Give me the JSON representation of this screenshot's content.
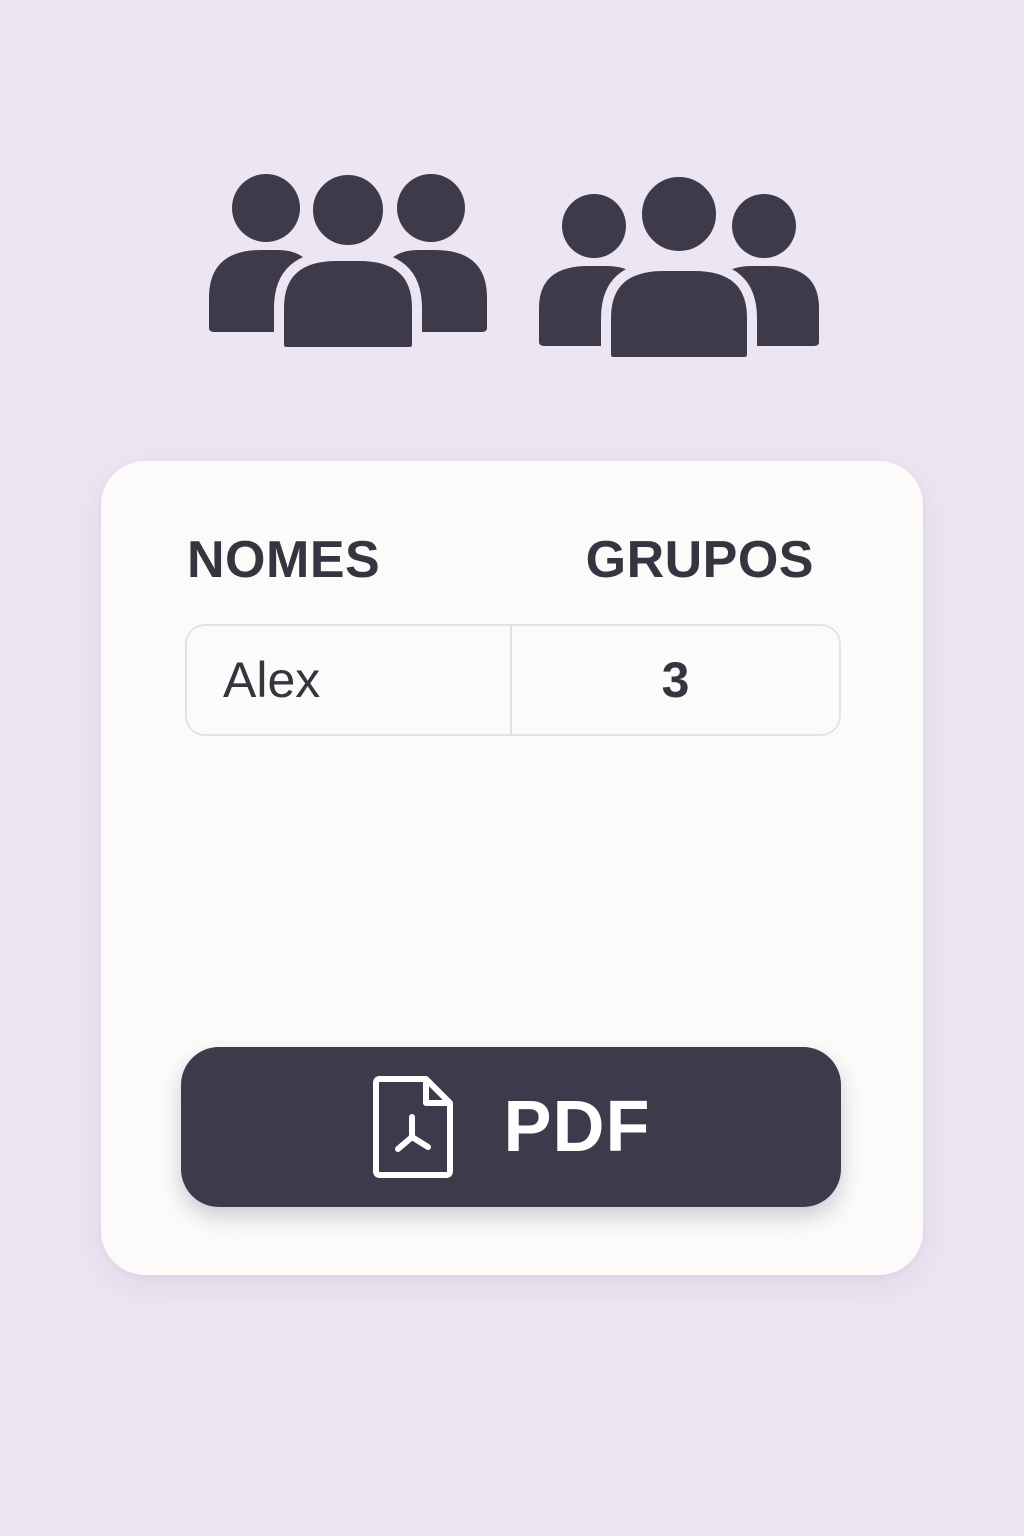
{
  "icons": {
    "left": "group-icon",
    "right": "group-icon",
    "button": "pdf-file-icon"
  },
  "table": {
    "headers": {
      "names": "NOMES",
      "groups": "GRUPOS"
    },
    "rows": [
      {
        "name": "Alex",
        "groups": "3"
      }
    ]
  },
  "pdf_button": {
    "label": "PDF"
  },
  "colors": {
    "background": "#ede6f2",
    "card": "#fcfbfa",
    "accent_dark": "#3c3a4b",
    "text": "#36343f",
    "border": "#e4e1ea"
  }
}
